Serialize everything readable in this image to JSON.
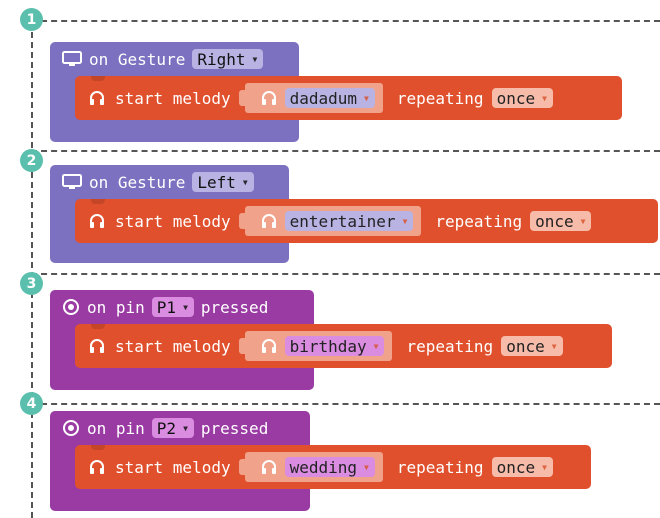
{
  "steps": [
    "1",
    "2",
    "3",
    "4"
  ],
  "colors": {
    "step_badge": "#5bbfad",
    "gesture_block": "#7c71c0",
    "pin_block": "#9a3aa3",
    "melody_block": "#e0502d"
  },
  "blocks": [
    {
      "event_icon": "display-icon",
      "event_prefix": "on Gesture",
      "event_value": "Right",
      "event_suffix": "",
      "stmt_label": "start melody",
      "melody": "dadadum",
      "repeat_label": "repeating",
      "repeat_value": "once"
    },
    {
      "event_icon": "display-icon",
      "event_prefix": "on Gesture",
      "event_value": "Left",
      "event_suffix": "",
      "stmt_label": "start melody",
      "melody": "entertainer",
      "repeat_label": "repeating",
      "repeat_value": "once"
    },
    {
      "event_icon": "target-icon",
      "event_prefix": "on pin",
      "event_value": "P1",
      "event_suffix": "pressed",
      "stmt_label": "start melody",
      "melody": "birthday",
      "repeat_label": "repeating",
      "repeat_value": "once"
    },
    {
      "event_icon": "target-icon",
      "event_prefix": "on pin",
      "event_value": "P2",
      "event_suffix": "pressed",
      "stmt_label": "start melody",
      "melody": "wedding",
      "repeat_label": "repeating",
      "repeat_value": "once"
    }
  ]
}
